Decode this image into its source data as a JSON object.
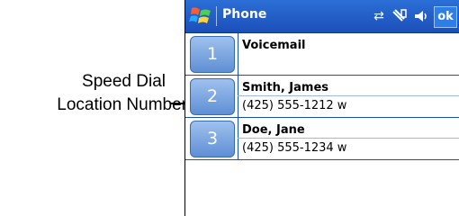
{
  "callout": {
    "line1": "Speed Dial",
    "line2": "Location Number"
  },
  "app": {
    "title": "Phone",
    "ok_label": "ok",
    "status_icons": [
      "connectivity-icon",
      "phone-signal-icon",
      "volume-icon"
    ]
  },
  "speed_dial": [
    {
      "slot": "1",
      "name": "Voicemail",
      "number": ""
    },
    {
      "slot": "2",
      "name": "Smith, James",
      "number": "(425) 555-1212 w"
    },
    {
      "slot": "3",
      "name": "Doe, Jane",
      "number": "(425) 555-1234 w"
    }
  ],
  "colors": {
    "titlebar": "#1b4fb8",
    "badge": "#6f9cdc",
    "ok": "#2f7ee8"
  }
}
